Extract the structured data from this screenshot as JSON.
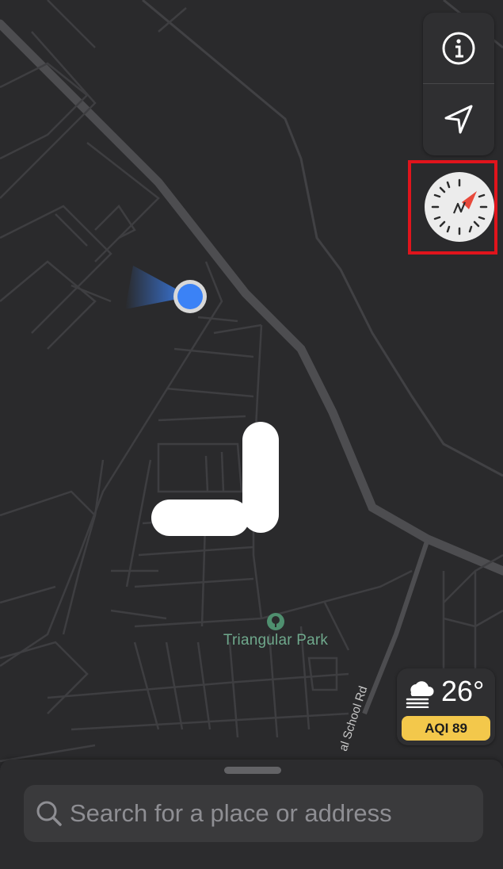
{
  "map": {
    "park_label": "Triangular Park",
    "street_label": "al School Rd",
    "park_icon": "tree-icon"
  },
  "controls": {
    "info_icon": "info-icon",
    "location_icon": "location-arrow-icon",
    "compass_icon": "compass-icon",
    "compass_accent": "#e8493b",
    "highlight_color": "#e0141c"
  },
  "weather": {
    "icon": "cloud-fog-icon",
    "temperature": "26°",
    "aqi_label": "AQI 89",
    "aqi_color": "#f3c84b"
  },
  "search": {
    "placeholder": "Search for a place or address",
    "value": ""
  },
  "colors": {
    "map_background": "#2a2a2c",
    "road_major": "#4a4a4c",
    "road_minor": "#3f3f42",
    "user_dot": "#3b82f6"
  }
}
